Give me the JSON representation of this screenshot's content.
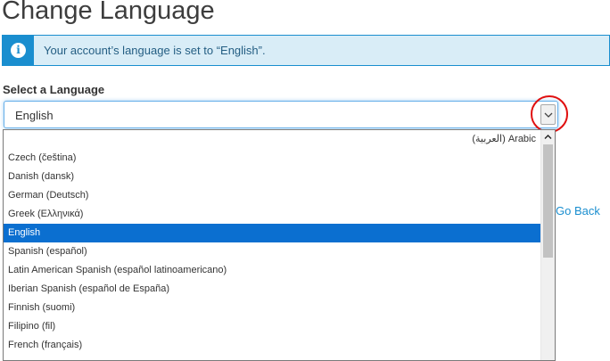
{
  "page": {
    "title": "Change Language"
  },
  "alert": {
    "icon": "info-icon",
    "icon_glyph": "i",
    "message": "Your account’s language is set to “English”."
  },
  "form": {
    "label": "Select a Language",
    "selected_value": "English",
    "caret_icon": "chevron-down-icon"
  },
  "links": {
    "go_back": "Go Back"
  },
  "dropdown": {
    "options": [
      {
        "label": "(العربية) Arabic",
        "rtl": true
      },
      {
        "label": "Czech (čeština)"
      },
      {
        "label": "Danish (dansk)"
      },
      {
        "label": "German (Deutsch)"
      },
      {
        "label": "Greek (Ελληνικά)"
      },
      {
        "label": "English",
        "selected": true
      },
      {
        "label": "Spanish (español)"
      },
      {
        "label": "Latin American Spanish (español latinoamericano)"
      },
      {
        "label": "Iberian Spanish (español de España)"
      },
      {
        "label": "Finnish (suomi)"
      },
      {
        "label": "Filipino (fil)"
      },
      {
        "label": "French (français)"
      }
    ],
    "scroll_up_icon": "chevron-up-icon"
  },
  "colors": {
    "accent": "#1a8ecf",
    "alert_bg": "#d9edf7",
    "selected_option": "#0b6fd0",
    "annotation_circle": "#e01010"
  }
}
